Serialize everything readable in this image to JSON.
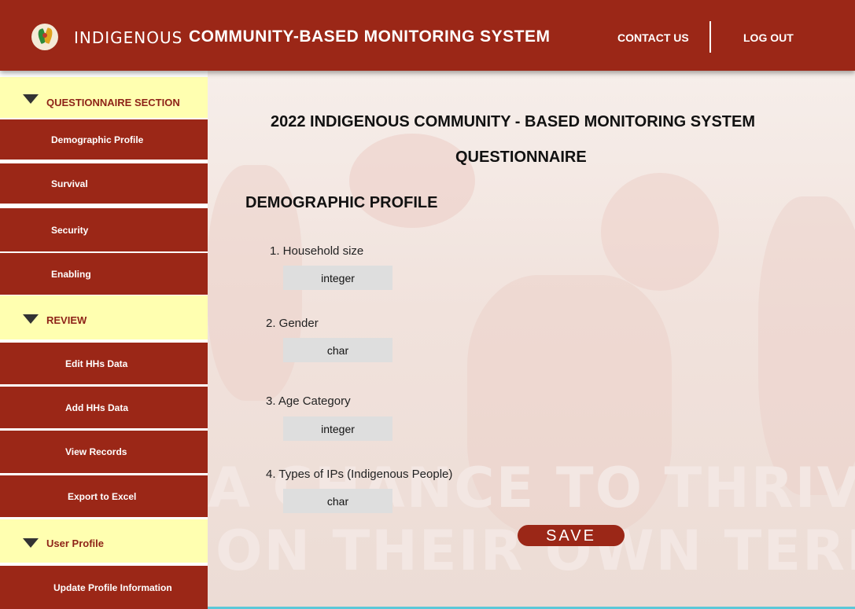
{
  "header": {
    "brand": "INDIGENOUS",
    "app_title": "COMMUNITY-BASED MONITORING SYSTEM",
    "contact_label": "CONTACT US",
    "logout_label": "LOG OUT",
    "color": "#9b2717"
  },
  "sidebar": {
    "sections": [
      {
        "label": "QUESTIONNAIRE SECTION",
        "items": [
          "Demographic Profile",
          "Survival",
          "Security",
          "Enabling"
        ]
      },
      {
        "label": "REVIEW",
        "items": [
          "Edit HHs Data",
          "Add HHs Data",
          "View Records",
          "Export to Excel"
        ]
      },
      {
        "label": "User Profile",
        "items": [
          "Update Profile Information"
        ]
      }
    ],
    "section_color": "#ffffb0",
    "item_color": "#9b2717"
  },
  "main": {
    "title": "2022 INDIGENOUS COMMUNITY - BASED MONITORING SYSTEM",
    "subtitle": "QUESTIONNAIRE",
    "section_title": "DEMOGRAPHIC PROFILE",
    "background_text": [
      "A CHANCE TO THRIVE",
      "ON THEIR OWN TERMS"
    ],
    "questions": [
      {
        "label": "1.  Household size",
        "value": "integer"
      },
      {
        "label": "2. Gender",
        "value": "char"
      },
      {
        "label": "3. Age Category",
        "value": "integer"
      },
      {
        "label": "4. Types of IPs (Indigenous People)",
        "value": "char"
      }
    ],
    "save_label": "SAVE"
  }
}
